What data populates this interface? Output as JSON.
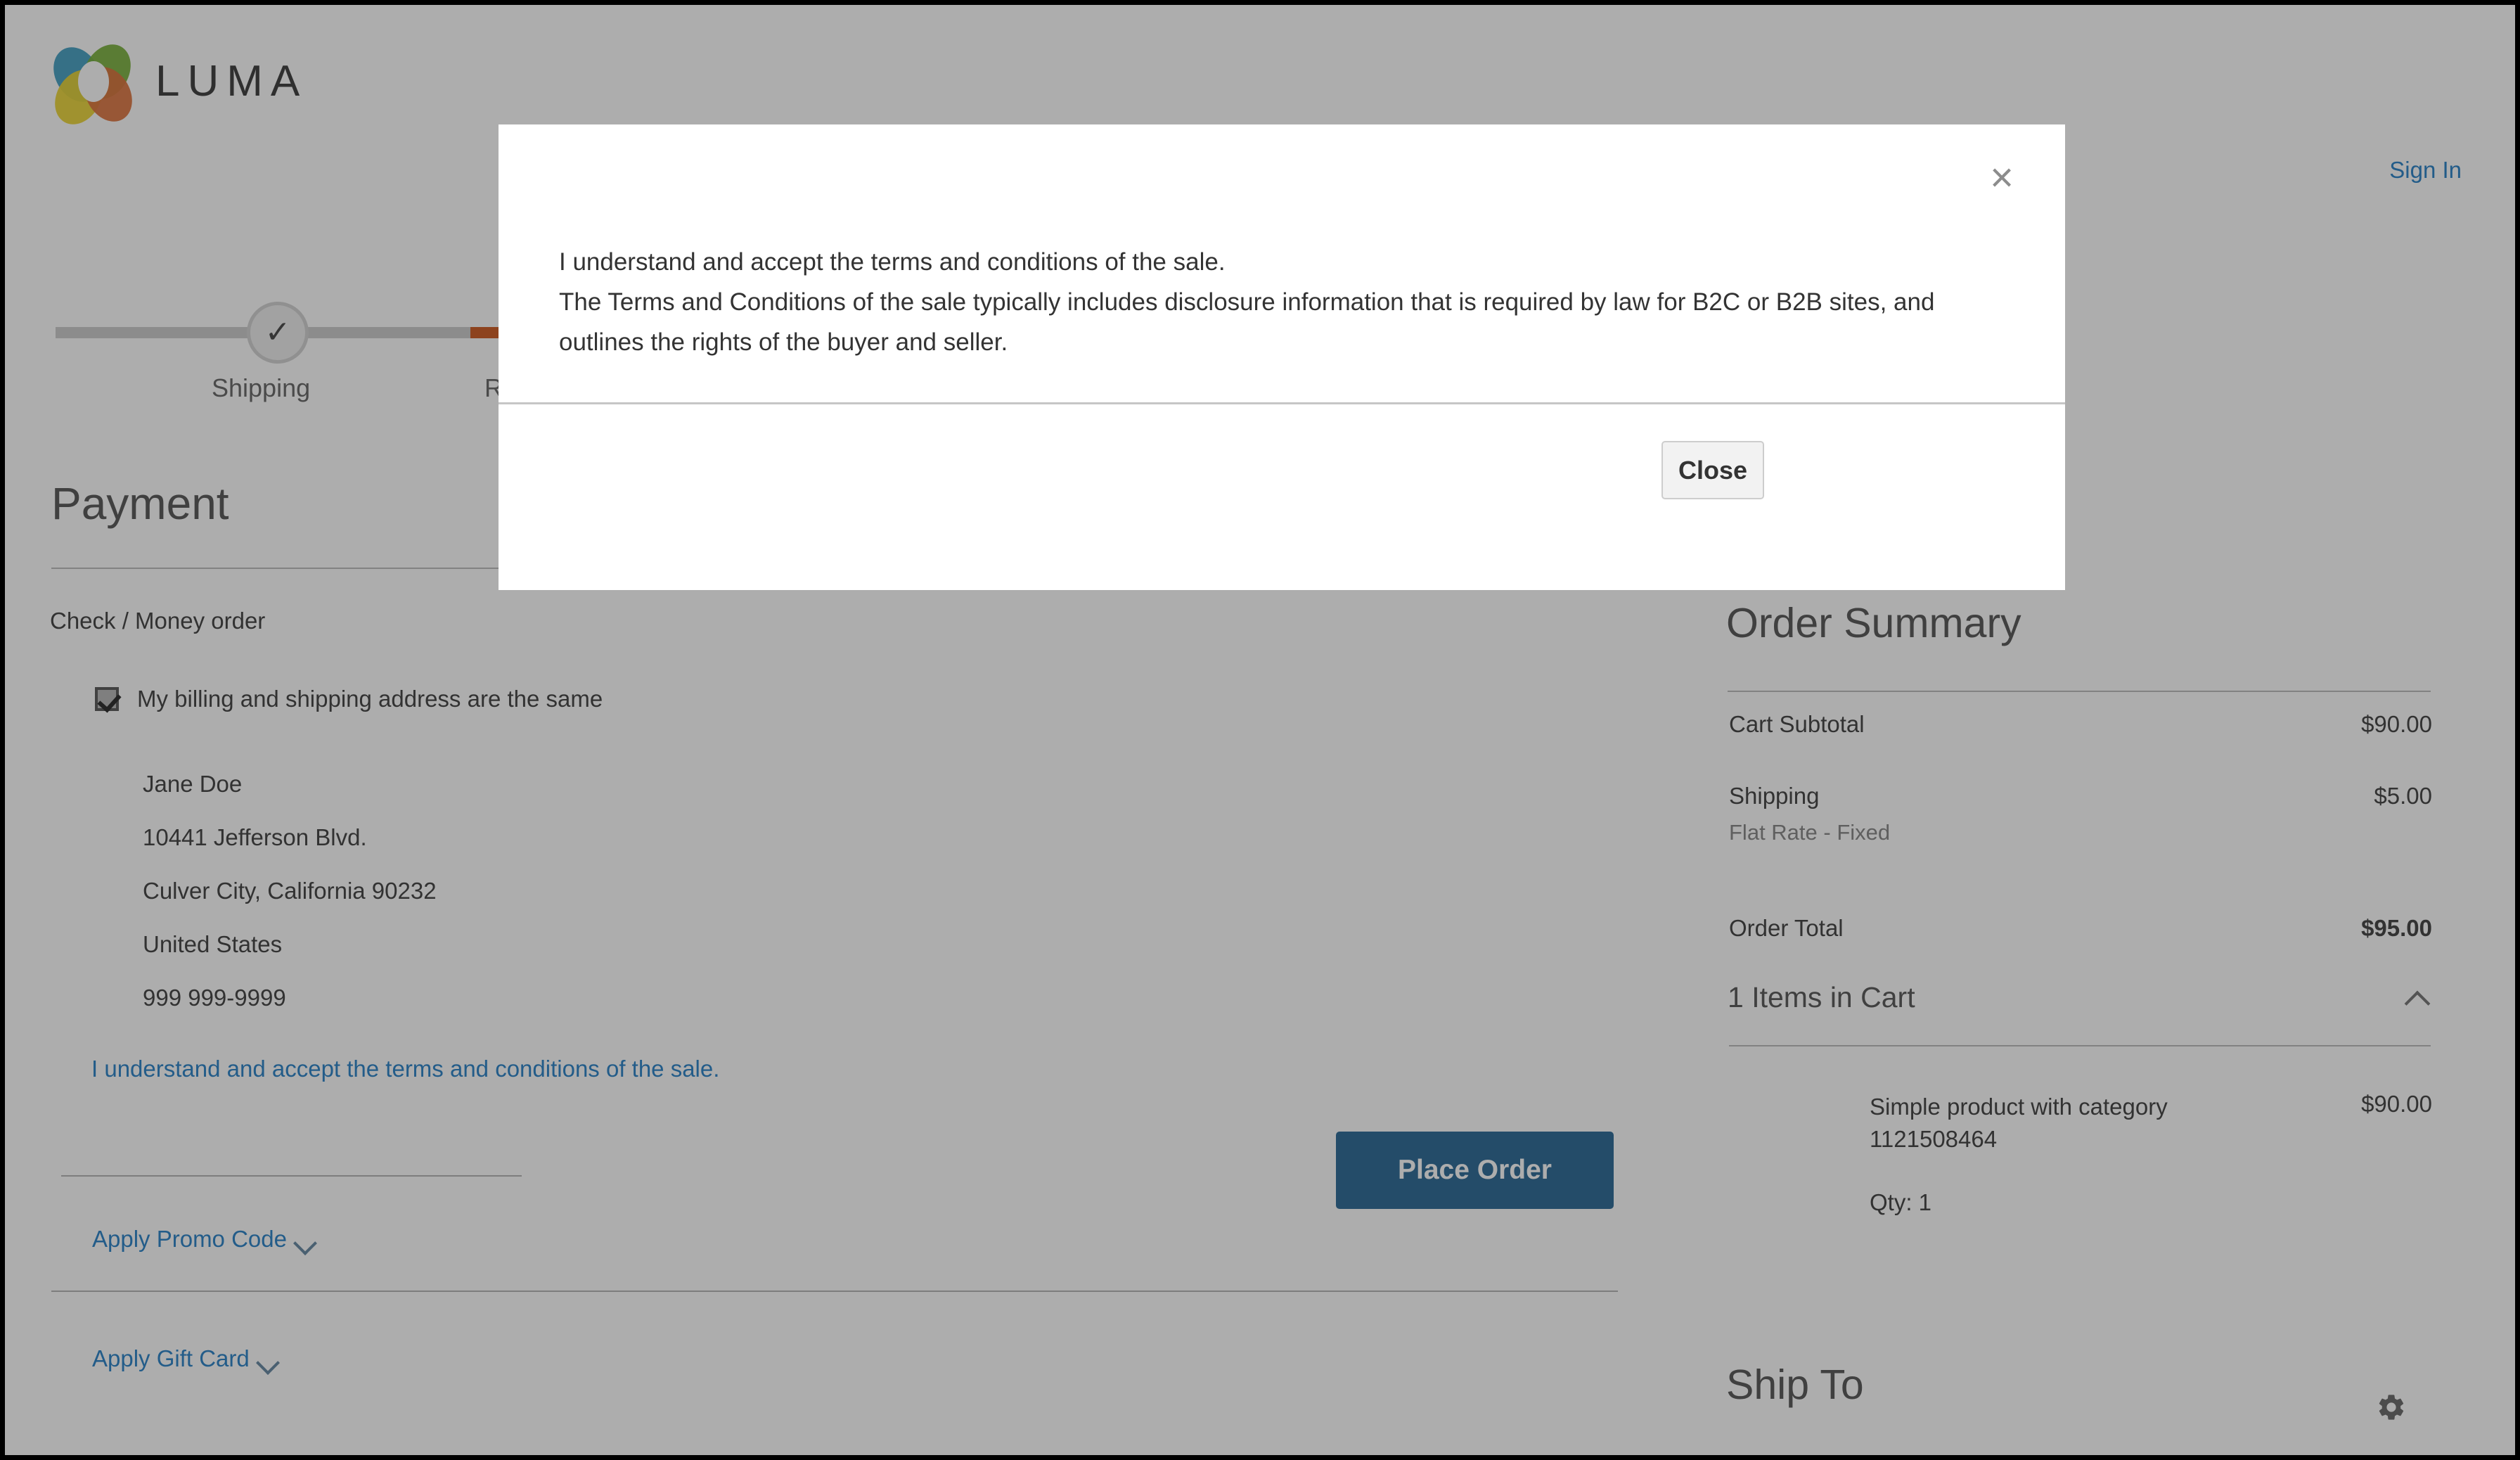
{
  "header": {
    "logo_text": "LUMA",
    "sign_in_label": "Sign In"
  },
  "progress": {
    "step_shipping": "Shipping",
    "step_review": "Rev",
    "accent_color": "#ca4f12"
  },
  "payment": {
    "title": "Payment",
    "method_label": "Check / Money order",
    "billing_same_label": "My billing and shipping address are the same",
    "address": [
      "Jane Doe",
      "10441 Jefferson Blvd.",
      "Culver City, California 90232",
      "United States",
      "999 999-9999"
    ],
    "terms_link_label": "I understand and accept the terms and conditions of the sale.",
    "place_order_label": "Place Order",
    "promo_label": "Apply Promo Code",
    "gift_card_label": "Apply Gift Card",
    "button_color": "#1b5e8e",
    "link_color": "#1979c3"
  },
  "summary": {
    "title": "Order Summary",
    "rows": [
      {
        "label": "Cart Subtotal",
        "value": "$90.00"
      },
      {
        "label": "Shipping",
        "value": "$5.00",
        "sub": "Flat Rate - Fixed"
      },
      {
        "label": "Order Total",
        "value": "$95.00"
      }
    ],
    "items_header": "1 Items in Cart",
    "item": {
      "name": "Simple product with category 1121508464",
      "price": "$90.00",
      "qty": "Qty: 1"
    },
    "ship_to_title": "Ship To"
  },
  "modal": {
    "line1": "I understand and accept the terms and conditions of the sale.",
    "line2": "The Terms and Conditions of the sale typically includes disclosure information that is required by law for B2C or B2B sites, and outlines the rights of the buyer and seller.",
    "close_button_label": "Close",
    "close_icon_glyph": "×"
  }
}
